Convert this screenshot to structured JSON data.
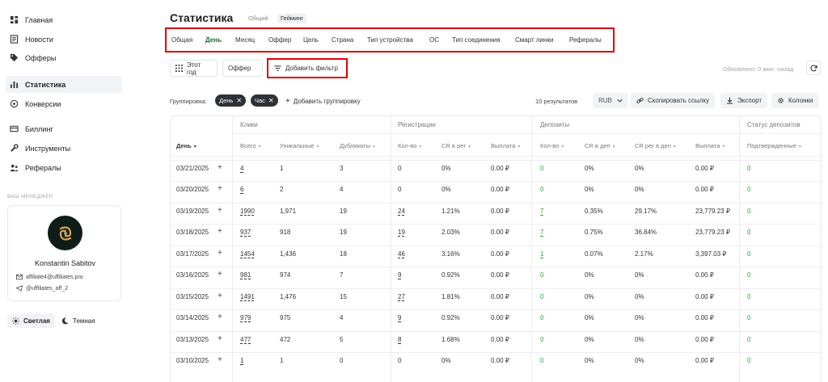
{
  "sidebar": {
    "items": [
      {
        "label": "Главная",
        "icon": "dashboard-icon",
        "active": false
      },
      {
        "label": "Новости",
        "icon": "news-icon",
        "active": false
      },
      {
        "label": "Офферы",
        "icon": "tag-icon",
        "active": false
      },
      {
        "label": "Статистика",
        "icon": "bar-chart-icon",
        "active": true
      },
      {
        "label": "Конверсии",
        "icon": "conversions-icon",
        "active": false
      },
      {
        "label": "Биллинг",
        "icon": "card-icon",
        "active": false
      },
      {
        "label": "Инструменты",
        "icon": "wrench-icon",
        "active": false
      },
      {
        "label": "Рефералы",
        "icon": "referrals-icon",
        "active": false
      }
    ],
    "manager": {
      "title": "ВАШ МЕНЕДЖЕР",
      "name": "Konstantin Sabitov",
      "email": "affiliate4@uffiliates.pro",
      "telegram": "@uffiliates_aff_2"
    },
    "theme": {
      "light": "Светлая",
      "dark": "Темная"
    }
  },
  "header": {
    "title": "Статистика",
    "modes": [
      "Общий",
      "Гейминг"
    ],
    "active_mode": "Гейминг",
    "tabs": [
      "Общая",
      "День",
      "Месяц",
      "Оффер",
      "Цель",
      "Страна",
      "Тип устройства",
      "ОС",
      "Тип соединения",
      "Смарт линки",
      "Рефералы"
    ],
    "active_tab": "День"
  },
  "toolbar": {
    "period": "Этот год",
    "offer": "Оффер",
    "add_filter": "Добавить фильтр",
    "updated": "Обновлено: 0 мин. назад"
  },
  "grouping": {
    "label": "Группировка:",
    "chips": [
      "День",
      "Час"
    ],
    "add": "Добавить группировку",
    "results": "10  результатов",
    "currency": "RUB",
    "copy_link": "Скопировать ссылку",
    "export": "Экспорт",
    "columns": "Колонки"
  },
  "table": {
    "groups": [
      "Клики",
      "Регистрации",
      "Депозиты",
      "Статус депозитов"
    ],
    "columns": [
      "День",
      "Всего",
      "Уникальные",
      "Дубликаты",
      "Кол-во",
      "CR в рег",
      "Выплата",
      "Кол-во",
      "CR в деп",
      "CR рег в деп",
      "Выплата",
      "Подтвержденные"
    ],
    "rows": [
      [
        "03/21/2025",
        "4",
        "1",
        "3",
        "0",
        "0%",
        "0.00 ₽",
        "0",
        "0%",
        "0%",
        "0.00 ₽",
        "0"
      ],
      [
        "03/20/2025",
        "6",
        "2",
        "4",
        "0",
        "0%",
        "0.00 ₽",
        "0",
        "0%",
        "0%",
        "0.00 ₽",
        "0"
      ],
      [
        "03/19/2025",
        "1990",
        "1,971",
        "19",
        "24",
        "1.21%",
        "0.00 ₽",
        "7",
        "0.35%",
        "29.17%",
        "23,779.23 ₽",
        "0"
      ],
      [
        "03/18/2025",
        "937",
        "918",
        "19",
        "19",
        "2.03%",
        "0.00 ₽",
        "7",
        "0.75%",
        "36.84%",
        "23,779.23 ₽",
        "0"
      ],
      [
        "03/17/2025",
        "1454",
        "1,436",
        "18",
        "46",
        "3.16%",
        "0.00 ₽",
        "1",
        "0.07%",
        "2.17%",
        "3,397.03 ₽",
        "0"
      ],
      [
        "03/16/2025",
        "981",
        "974",
        "7",
        "9",
        "0.92%",
        "0.00 ₽",
        "0",
        "0%",
        "0%",
        "0.00 ₽",
        "0"
      ],
      [
        "03/15/2025",
        "1491",
        "1,476",
        "15",
        "27",
        "1.81%",
        "0.00 ₽",
        "0",
        "0%",
        "0%",
        "0.00 ₽",
        "0"
      ],
      [
        "03/14/2025",
        "979",
        "975",
        "4",
        "9",
        "0.92%",
        "0.00 ₽",
        "0",
        "0%",
        "0%",
        "0.00 ₽",
        "0"
      ],
      [
        "03/13/2025",
        "477",
        "472",
        "5",
        "8",
        "1.68%",
        "0.00 ₽",
        "0",
        "0%",
        "0%",
        "0.00 ₽",
        "0"
      ],
      [
        "03/10/2025",
        "1",
        "1",
        "0",
        "0",
        "0%",
        "0.00 ₽",
        "0",
        "0%",
        "0%",
        "0.00 ₽",
        "0"
      ]
    ]
  },
  "colors": {
    "accent_green": "#2f9d47",
    "active_tab": "#1f6b2d",
    "highlight_red": "#e00000",
    "chip_bg": "#2e3136"
  }
}
